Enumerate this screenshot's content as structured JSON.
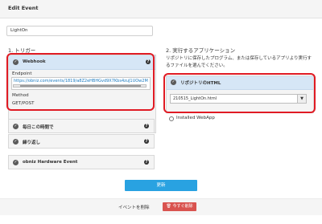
{
  "header": {
    "title": "Edit Event"
  },
  "event_name": {
    "value": "LightOn"
  },
  "trigger": {
    "heading": "1. トリガー",
    "webhook": {
      "label": "Webhook",
      "endpoint_label": "Endpoint",
      "endpoint_value": "https://obniz.com/events/1819/a8Z2eHBHGvd9X7Kbs4zuJ1UOw2MeN",
      "method_label": "Method",
      "method_value": "GET/POST"
    },
    "other": [
      "毎日この時間で",
      "繰り返し",
      "obniz Hardware Event"
    ]
  },
  "app": {
    "heading": "2. 実行するアプリケーション",
    "description": "リポジトリに保存したプログラム、または保存しているアプリより実行するファイルを選んでください。",
    "repo_label": "リポジトリのHTML",
    "selected_file": "210515_LightOn.html",
    "installed_label": "Installed WebApp"
  },
  "actions": {
    "update_label": "更新",
    "delete_text": "イベントを削除",
    "delete_button": "今すぐ削除"
  },
  "colors": {
    "accent": "#29a2e1",
    "danger": "#d9534f",
    "highlight_frame": "#e01b24",
    "selected_head": "#d6e6f6"
  }
}
